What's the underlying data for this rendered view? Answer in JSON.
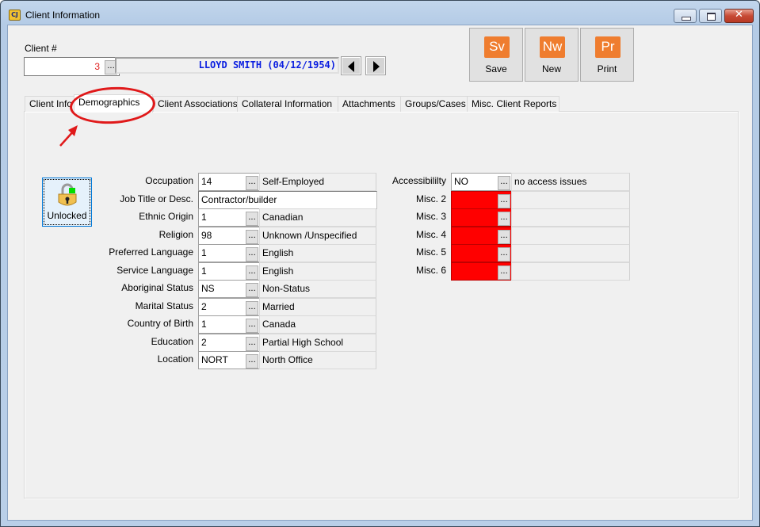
{
  "window": {
    "title": "Client Information",
    "app_icon": "CJ",
    "controls": [
      "minimize",
      "maximize",
      "close"
    ]
  },
  "client": {
    "label": "Client #",
    "number": "3",
    "lookup_label": "...",
    "name_display": "LLOYD SMITH  (04/12/1954)",
    "prev_icon": "triangle-left-icon",
    "next_icon": "triangle-right-icon"
  },
  "toolbar": {
    "buttons": [
      {
        "icon_text": "Sv",
        "label": "Save"
      },
      {
        "icon_text": "Nw",
        "label": "New"
      },
      {
        "icon_text": "Pr",
        "label": "Print"
      }
    ],
    "icon_color": "#ef7d2f"
  },
  "tabs": [
    {
      "label": "Client Info",
      "active": false
    },
    {
      "label": "Demographics",
      "active": true
    },
    {
      "label": "Client Associations",
      "active": false
    },
    {
      "label": "Collateral Information",
      "active": false
    },
    {
      "label": "Attachments",
      "active": false
    },
    {
      "label": "Groups/Cases",
      "active": false
    },
    {
      "label": "Misc. Client Reports",
      "active": false
    }
  ],
  "lock": {
    "label": "Unlocked",
    "icon": "padlock-unlocked-icon"
  },
  "demographics": [
    {
      "label": "Occupation",
      "code": "14",
      "desc": "Self-Employed"
    },
    {
      "label": "Job Title or Desc.",
      "text": "Contractor/builder"
    },
    {
      "label": "Ethnic Origin",
      "code": "1",
      "desc": "Canadian"
    },
    {
      "label": "Religion",
      "code": "98",
      "desc": "Unknown /Unspecified"
    },
    {
      "label": "Preferred Language",
      "code": "1",
      "desc": "English"
    },
    {
      "label": "Service Language",
      "code": "1",
      "desc": "English"
    },
    {
      "label": "Aboriginal Status",
      "code": "NS",
      "desc": "Non-Status"
    },
    {
      "label": "Marital Status",
      "code": "2",
      "desc": "Married"
    },
    {
      "label": "Country of Birth",
      "code": "1",
      "desc": "Canada"
    },
    {
      "label": "Education",
      "code": "2",
      "desc": "Partial High School"
    },
    {
      "label": "Location",
      "code": "NORT",
      "desc": "North Office"
    }
  ],
  "misc_fields": [
    {
      "label": "Accessibililty",
      "code": "NO",
      "desc": "no access issues",
      "required_empty": false
    },
    {
      "label": "Misc. 2",
      "code": "",
      "desc": "",
      "required_empty": true
    },
    {
      "label": "Misc. 3",
      "code": "",
      "desc": "",
      "required_empty": true
    },
    {
      "label": "Misc. 4",
      "code": "",
      "desc": "",
      "required_empty": true
    },
    {
      "label": "Misc. 5",
      "code": "",
      "desc": "",
      "required_empty": true
    },
    {
      "label": "Misc. 6",
      "code": "",
      "desc": "",
      "required_empty": true
    }
  ],
  "ellipsis": "...",
  "colors": {
    "required_field": "#ff0000",
    "client_name": "#0a1ee0",
    "client_number": "#e02020",
    "annotation": "#e0191a"
  }
}
